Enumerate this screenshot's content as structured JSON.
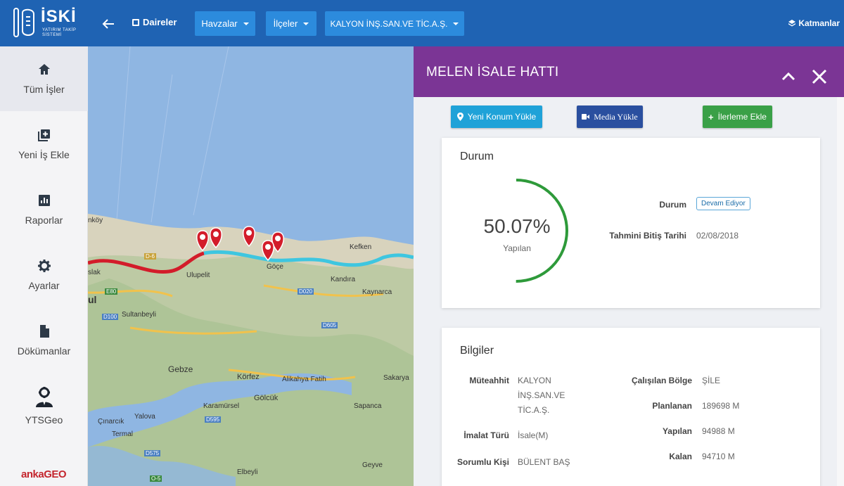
{
  "header": {
    "brand": "İSKİ",
    "brand_sub": "YATIRIM TAKİP SİSTEMİ",
    "daireler": "Daireler",
    "dropdowns": [
      "Havzalar",
      "İlçeler",
      "KALYON İNŞ.SAN.VE TİC.A.Ş."
    ],
    "katmanlar": "Katmanlar"
  },
  "sidebar": {
    "items": [
      {
        "label": "Tüm İşler",
        "icon": "home-icon"
      },
      {
        "label": "Yeni İş Ekle",
        "icon": "add-box-icon"
      },
      {
        "label": "Raporlar",
        "icon": "chart-icon"
      },
      {
        "label": "Ayarlar",
        "icon": "gear-icon"
      },
      {
        "label": "Dökümanlar",
        "icon": "document-icon"
      },
      {
        "label": "YTSGeo",
        "icon": "user-gear-icon"
      }
    ],
    "vendor_logo": "ankaGEO"
  },
  "map": {
    "labels": [
      "nköy",
      "slak",
      "ul",
      "Ulupelit",
      "Sultanbeyli",
      "Gebze",
      "Körfez",
      "Gölcük",
      "Alikahya Fatih",
      "Karamürsel",
      "Çınarcık",
      "Yalova",
      "Termal",
      "Elbeyli",
      "Kefken",
      "Kandıra",
      "Kaynarca",
      "Sakarya",
      "Sapanca",
      "Geyve",
      "Göçe",
      "D-6",
      "E80",
      "D100",
      "D020",
      "D605",
      "D595",
      "D575",
      "O-5"
    ]
  },
  "panel": {
    "title": "MELEN İSALE HATTI",
    "actions": [
      {
        "label": "Yeni Konum Yükle",
        "color": "#1fa2d8",
        "icon": "location-pin-icon"
      },
      {
        "label": "Media Yükle",
        "color": "#2a4f9f",
        "icon": "video-icon"
      },
      {
        "label": "İlerleme Ekle",
        "color": "#3aa047",
        "icon": "plus-icon"
      }
    ],
    "durum": {
      "title": "Durum",
      "progress": 50.07,
      "progress_text": "50.07%",
      "progress_sub": "Yapılan",
      "status_label": "Durum",
      "status_value": "Devam Ediyor",
      "end_label": "Tahmini Bitiş Tarihi",
      "end_value": "02/08/2018"
    },
    "bilgiler": {
      "title": "Bilgiler",
      "muteahhit_label": "Müteahhit",
      "muteahhit_lines": [
        "KALYON",
        "İNŞ.SAN.VE",
        "TİC.A.Ş."
      ],
      "imalat_label": "İmalat Türü",
      "imalat_value": "İsale(M)",
      "sorumlu_label": "Sorumlu Kişi",
      "sorumlu_value": "BÜLENT BAŞ",
      "bolge_label": "Çalışılan Bölge",
      "bolge_value": "ŞİLE",
      "planlanan_label": "Planlanan",
      "planlanan_value": "189698 M",
      "yapilan_label": "Yapılan",
      "yapilan_value": "94988 M",
      "kalan_label": "Kalan",
      "kalan_value": "94710 M"
    }
  },
  "colors": {
    "topbar": "#1f63b3",
    "dropdown": "#2c8bdd",
    "panel_header": "#7b3595",
    "progress": "#2e9a3a",
    "route_red": "#d31c2a",
    "route_cyan": "#3ec6e0"
  }
}
